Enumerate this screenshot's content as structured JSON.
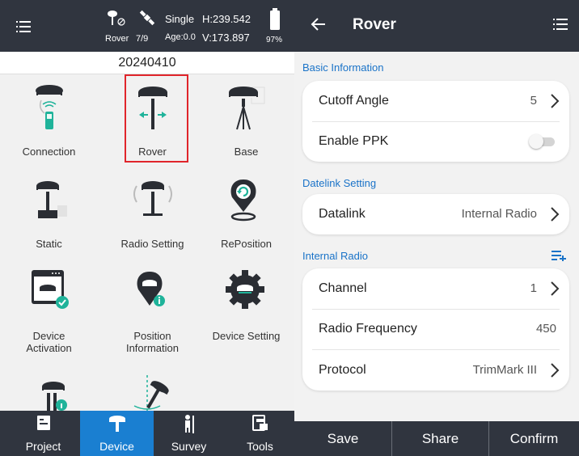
{
  "left": {
    "status": {
      "rover_label": "Rover",
      "sat_count": "7/9",
      "solution": "Single",
      "age": "Age:0.0",
      "h_value": "H:239.542",
      "v_value": "V:173.897",
      "battery": "97%"
    },
    "date": "20240410",
    "grid_items": [
      {
        "label": "Connection",
        "icon": "connection-icon"
      },
      {
        "label": "Rover",
        "icon": "rover-icon"
      },
      {
        "label": "Base",
        "icon": "base-icon"
      },
      {
        "label": "Static",
        "icon": "static-icon"
      },
      {
        "label": "Radio Setting",
        "icon": "radio-setting-icon"
      },
      {
        "label": "RePosition",
        "icon": "reposition-icon"
      },
      {
        "label": "Device\nActivation",
        "icon": "device-activation-icon"
      },
      {
        "label": "Position\nInformation",
        "icon": "position-information-icon"
      },
      {
        "label": "Device Setting",
        "icon": "device-setting-icon"
      }
    ],
    "nav": [
      {
        "label": "Project",
        "icon": "project-icon"
      },
      {
        "label": "Device",
        "icon": "device-icon"
      },
      {
        "label": "Survey",
        "icon": "survey-icon"
      },
      {
        "label": "Tools",
        "icon": "tools-icon"
      }
    ]
  },
  "right": {
    "title": "Rover",
    "sections": {
      "basic": "Basic Information",
      "datelink": "Datelink Setting",
      "radio": "Internal Radio"
    },
    "rows": {
      "cutoff_label": "Cutoff Angle",
      "cutoff_value": "5",
      "ppk_label": "Enable PPK",
      "ppk_enabled": false,
      "datalink_label": "Datalink",
      "datalink_value": "Internal Radio",
      "channel_label": "Channel",
      "channel_value": "1",
      "freq_label": "Radio Frequency",
      "freq_value": "450",
      "protocol_label": "Protocol",
      "protocol_value": "TrimMark III"
    },
    "buttons": {
      "save": "Save",
      "share": "Share",
      "confirm": "Confirm"
    }
  },
  "colors": {
    "header": "#30353f",
    "accent": "#1a7fd1",
    "teal": "#1fb39a",
    "highlight": "#e0252b"
  }
}
